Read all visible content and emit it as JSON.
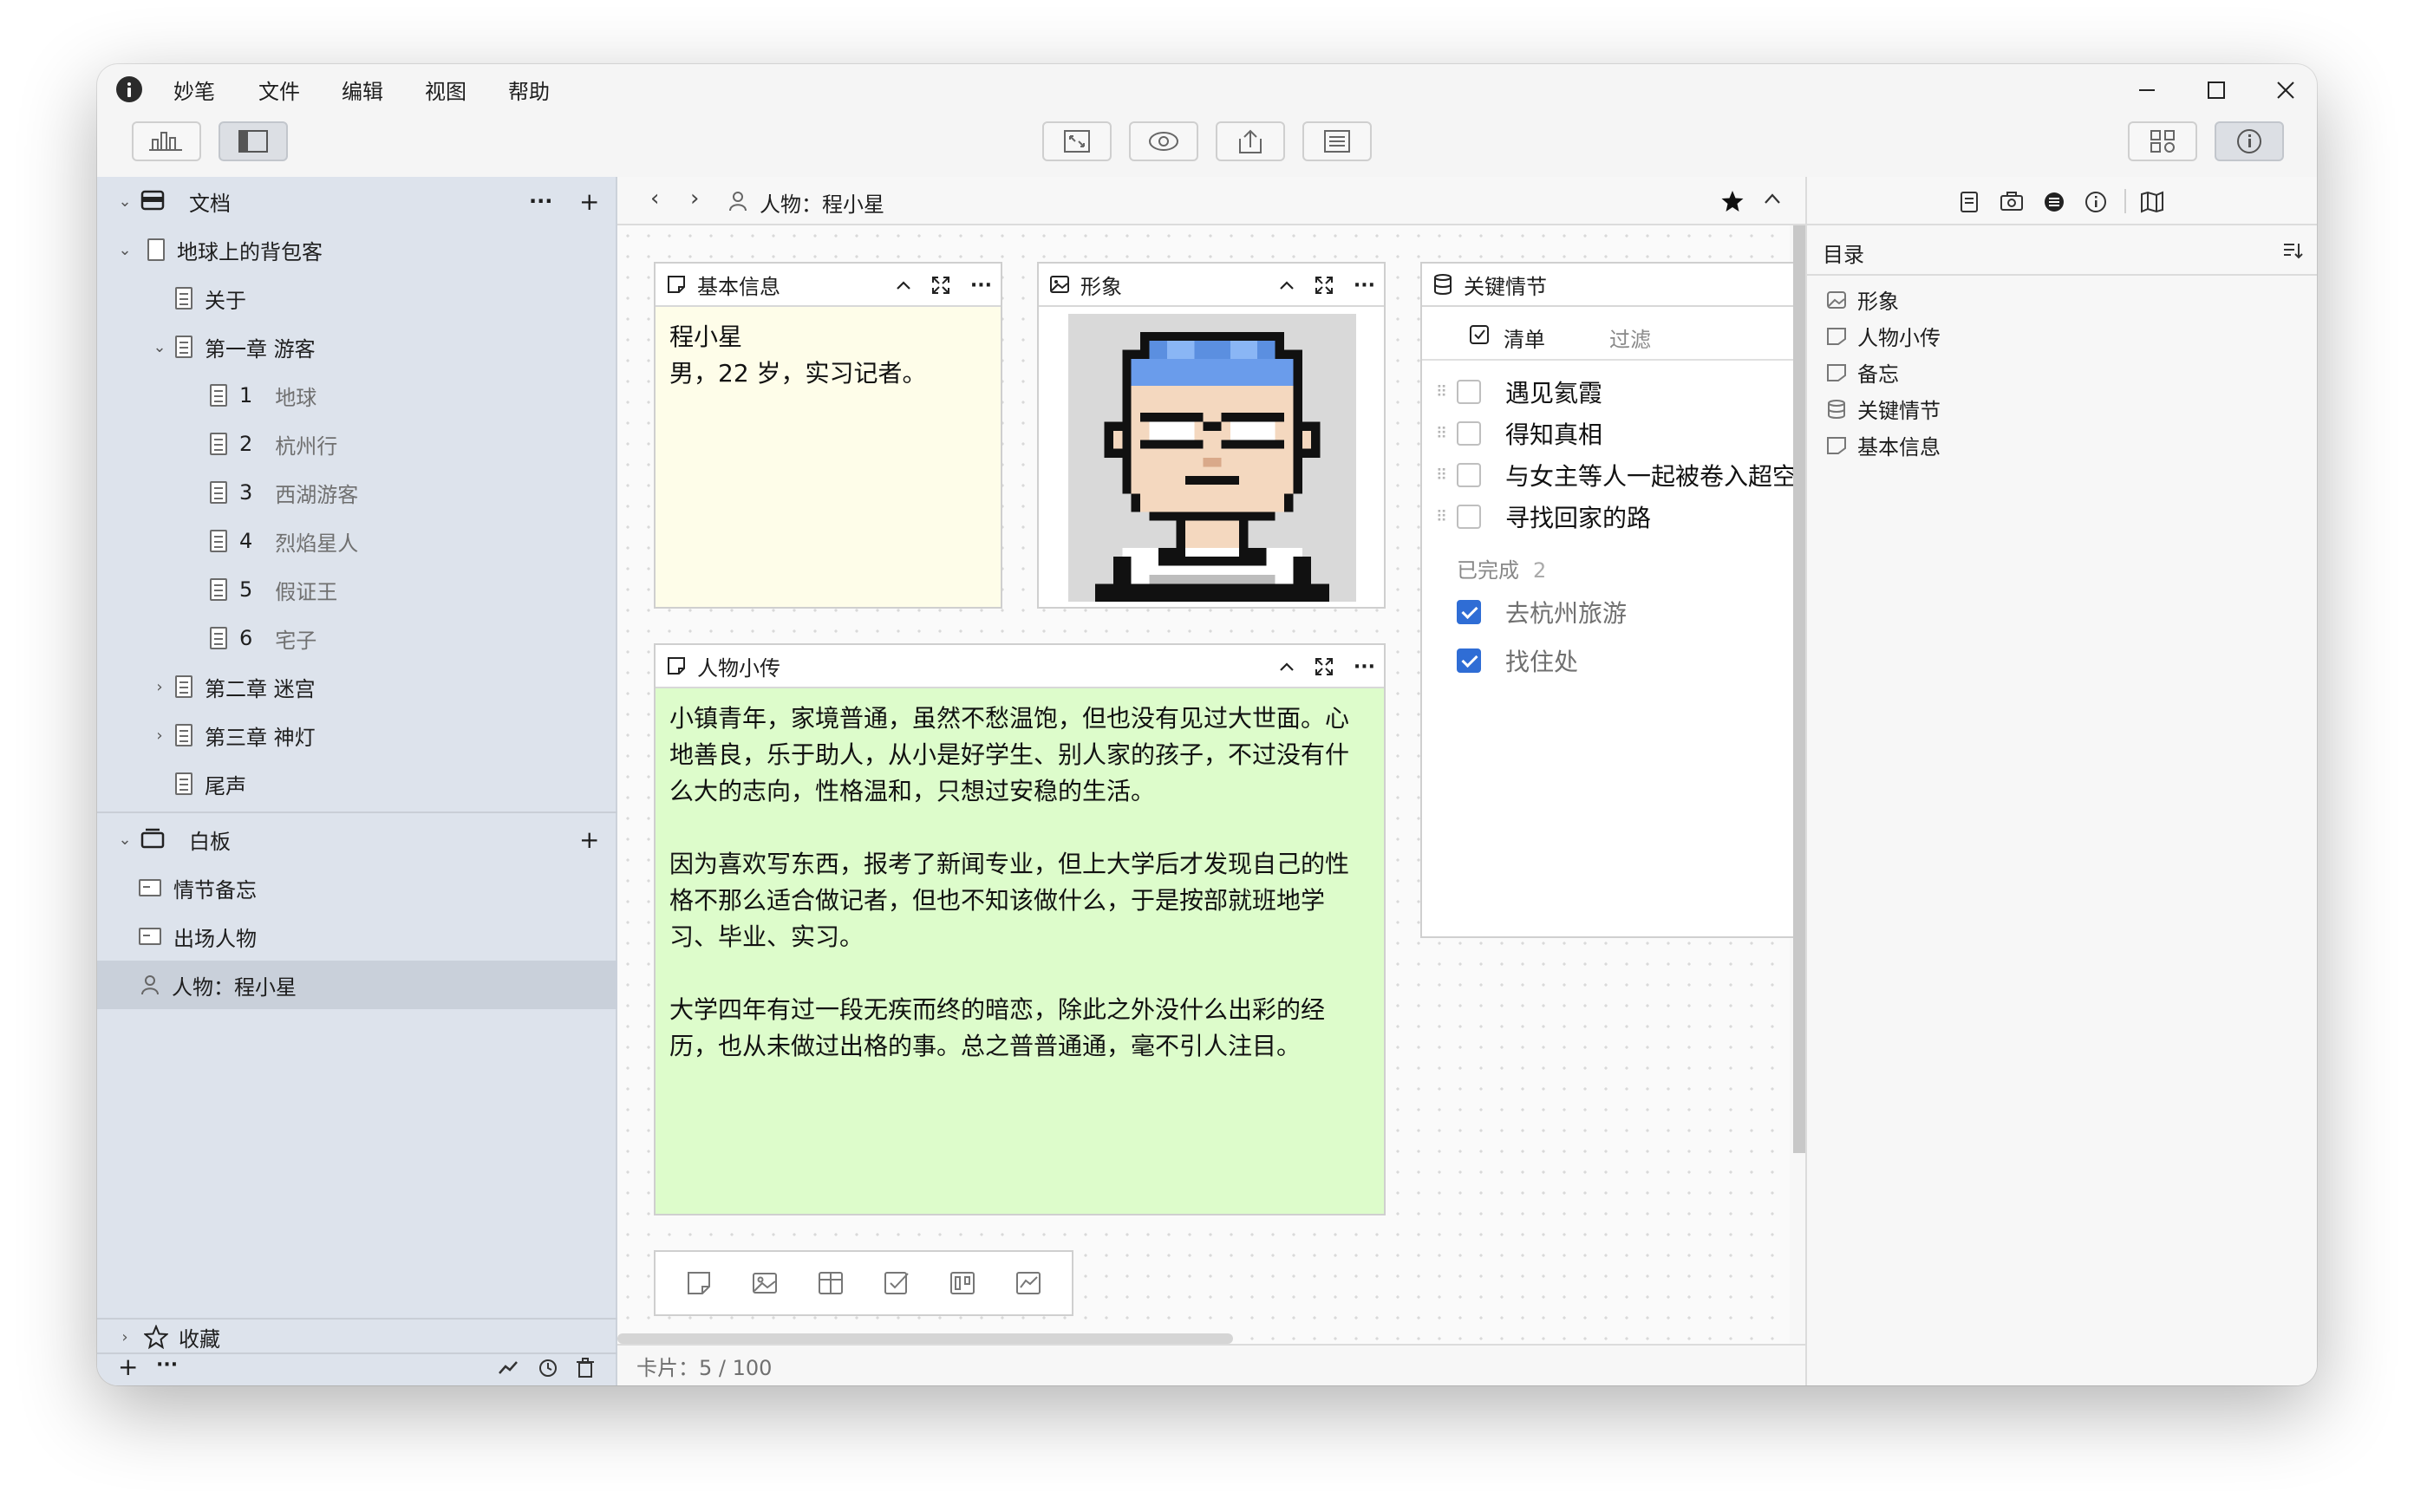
{
  "menu": [
    "妙笔",
    "文件",
    "编辑",
    "视图",
    "帮助"
  ],
  "sidebar": {
    "docs_header": "文档",
    "book": "地球上的背包客",
    "items": [
      {
        "label": "关于"
      },
      {
        "label": "第一章 游客"
      },
      {
        "num": "1",
        "label": "地球"
      },
      {
        "num": "2",
        "label": "杭州行"
      },
      {
        "num": "3",
        "label": "西湖游客"
      },
      {
        "num": "4",
        "label": "烈焰星人"
      },
      {
        "num": "5",
        "label": "假证王"
      },
      {
        "num": "6",
        "label": "宅子"
      },
      {
        "label": "第二章 迷宫"
      },
      {
        "label": "第三章 神灯"
      },
      {
        "label": "尾声"
      }
    ],
    "whiteboard_header": "白板",
    "whiteboards": [
      "情节备忘",
      "出场人物",
      "人物：程小星"
    ],
    "favorites": "收藏"
  },
  "breadcrumb": "人物：程小星",
  "cards": {
    "basic": {
      "title": "基本信息",
      "line1": "程小星",
      "line2": "男，22 岁，实习记者。",
      "bg": "#fefde9"
    },
    "image": {
      "title": "形象"
    },
    "bio": {
      "title": "人物小传",
      "bg": "#ddfccb",
      "p1": "小镇青年，家境普通，虽然不愁温饱，但也没有见过大世面。心地善良，乐于助人，从小是好学生、别人家的孩子，不过没有什么大的志向，性格温和，只想过安稳的生活。",
      "p2": "因为喜欢写东西，报考了新闻专业，但上大学后才发现自己的性格不那么适合做记者，但也不知该做什么，于是按部就班地学习、毕业、实习。",
      "p3": "大学四年有过一段无疾而终的暗恋，除此之外没什么出彩的经历，也从未做过出格的事。总之普普通通，毫不引人注目。"
    },
    "plot": {
      "title": "关键情节",
      "tab_list": "清单",
      "tab_filter": "过滤",
      "tasks": [
        "遇见氦霞",
        "得知真相",
        "与女主等人一起被卷入超空",
        "寻找回家的路"
      ],
      "done_label": "已完成",
      "done_count": "2",
      "done_tasks": [
        "去杭州旅游",
        "找住处"
      ]
    }
  },
  "status": "卡片：5 / 100",
  "toc": {
    "title": "目录",
    "items": [
      "形象",
      "人物小传",
      "备忘",
      "关键情节",
      "基本信息"
    ]
  },
  "colors": {
    "accent": "#2f6dd5",
    "sidebar_bg": "#dde3ec",
    "selected": "#c9d0da"
  }
}
